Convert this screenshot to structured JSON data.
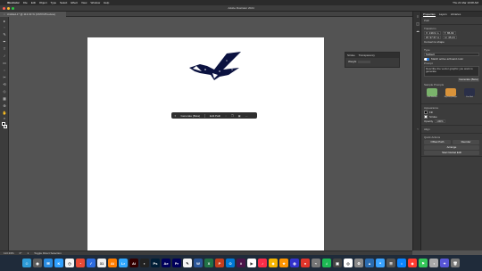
{
  "menubar": {
    "app": "Illustrator",
    "items": [
      "File",
      "Edit",
      "Object",
      "Type",
      "Select",
      "Effect",
      "View",
      "Window",
      "Help"
    ],
    "clock": "Thu 21 Mar 10:08 AM"
  },
  "window": {
    "title": "Adobe Illustrator 2024"
  },
  "tab": {
    "label": "Untitled-1* @ 113.33 % (CMYK/Preview)"
  },
  "tools": [
    "▸",
    "◦",
    "✎",
    "✒",
    "T",
    "/",
    "▭",
    "◌",
    "✂",
    "⟲",
    "◇",
    "▦",
    "⊕",
    "✋",
    "⌕"
  ],
  "context_bar": {
    "generate_label": "Generate (Beta)",
    "edit_path_label": "Edit Path",
    "more": "···"
  },
  "float_panel": {
    "tab1": "Stroke",
    "tab2": "Transparency",
    "row_label": "Weight"
  },
  "properties": {
    "tabs": [
      "Properties",
      "Layers",
      "Libraries"
    ],
    "path_label": "Path",
    "transform_label": "Transform",
    "x": "X: 139.9 m",
    "y": "Y: 86.82",
    "w": "W: 97.67 m",
    "h": "H: 45.24",
    "convert_label": "Convert to shape",
    "type_label": "Type",
    "type_value": "Subject",
    "match_label": "Match active artboard color",
    "prompt_label": "Prompt",
    "prompt_text": "Describe the vector graphic you want to generate",
    "generate_btn": "Generate (Beta)",
    "sample_label": "Sample Prompts",
    "samples": [
      "Cute Monster",
      "Big Juicy Burger",
      "Fire Bird"
    ],
    "appearance_label": "Appearance",
    "fill_label": "Fill",
    "stroke_label": "Stroke",
    "opacity_label": "Opacity",
    "opacity_value": "100%",
    "align_label": "Align",
    "quick_label": "Quick Actions",
    "offset_btn": "Offset Path",
    "reorder_btn": "Reorder",
    "arrange_btn": "Arrange",
    "trace_btn": "Start Global Edit"
  },
  "status": {
    "zoom": "113.33%",
    "angle": "0°",
    "artboard": "1",
    "tool": "Toggle Direct Selection"
  },
  "dock": [
    {
      "t": "☺",
      "c": "#2e9bd6"
    },
    {
      "t": "◉",
      "c": "#5c5c5c"
    },
    {
      "t": "✉",
      "c": "#2a8be0"
    },
    {
      "t": "K",
      "c": "#2fa0ff"
    },
    {
      "t": "◷",
      "c": "#f4f4f4"
    },
    {
      "t": "◔",
      "c": "#e84a35"
    },
    {
      "t": "✓",
      "c": "#2d6cdf"
    },
    {
      "t": "31",
      "c": "#f0f0f0"
    },
    {
      "t": "Ai",
      "c": "#ff7c00"
    },
    {
      "t": "Lr",
      "c": "#31a8ff"
    },
    {
      "t": "Ai",
      "c": "#330000"
    },
    {
      "t": "◐",
      "c": "#222"
    },
    {
      "t": "Ps",
      "c": "#001e36"
    },
    {
      "t": "Ae",
      "c": "#00005b"
    },
    {
      "t": "Pr",
      "c": "#00005b"
    },
    {
      "t": "✎",
      "c": "#f5f5f5"
    },
    {
      "t": "W",
      "c": "#2b579a"
    },
    {
      "t": "X",
      "c": "#217346"
    },
    {
      "t": "P",
      "c": "#c43e1c"
    },
    {
      "t": "O",
      "c": "#0078d4"
    },
    {
      "t": "#",
      "c": "#4a154b"
    },
    {
      "t": "▶",
      "c": "#fff"
    },
    {
      "t": "♪",
      "c": "#fa2d48"
    },
    {
      "t": "◆",
      "c": "#f7b500"
    },
    {
      "t": "★",
      "c": "#ff9500"
    },
    {
      "t": "◍",
      "c": "#33c"
    },
    {
      "t": "●",
      "c": "#e0352b"
    },
    {
      "t": "⌁",
      "c": "#777"
    },
    {
      "t": "♫",
      "c": "#1db954"
    },
    {
      "t": "▣",
      "c": "#444"
    },
    {
      "t": "◎",
      "c": "#fff"
    },
    {
      "t": "⚙",
      "c": "#888"
    },
    {
      "t": "▲",
      "c": "#2b6cb0"
    },
    {
      "t": "⚬",
      "c": "#3aa3ff"
    },
    {
      "t": "☰",
      "c": "#555"
    },
    {
      "t": "⌂",
      "c": "#0a84ff"
    },
    {
      "t": "◈",
      "c": "#ff3b30"
    },
    {
      "t": "⚑",
      "c": "#34c759"
    },
    {
      "t": "◑",
      "c": "#aaa"
    },
    {
      "t": "✦",
      "c": "#5856d6"
    },
    {
      "t": "🗑",
      "c": "#777"
    }
  ],
  "colors": {
    "accent": "#1473e6",
    "bird": "#0b1240"
  }
}
